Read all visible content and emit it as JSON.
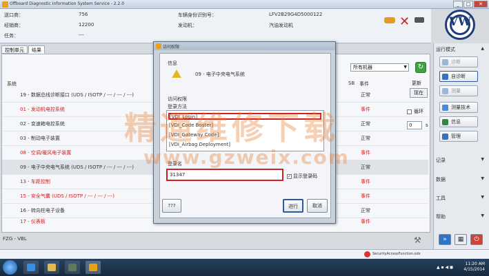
{
  "window": {
    "title": "Offboard Diagnostic Information System Service - 2.2.0",
    "buttons": [
      "_",
      "□",
      "✕"
    ]
  },
  "info": {
    "left_labels": [
      "送口商：",
      "经销商：",
      "任务："
    ],
    "left_values": [
      "756",
      "12200",
      "---"
    ],
    "mid_labels": [
      "车辆身份识别号：",
      "发动机："
    ],
    "mid_values": [
      "LFV2B29G4D5000122",
      "汽油发动机"
    ],
    "logo_text": "VW"
  },
  "tabs": [
    "控制单元",
    "结果"
  ],
  "list": {
    "col_system": "系统",
    "col_sb": "SB",
    "col_event": "事件",
    "filter_value": "所有机器",
    "update_label": "更新",
    "now_button": "现在",
    "cycle_label": "循环",
    "interval_value": "0",
    "interval_unit": "s",
    "rows": [
      {
        "name": "19 - 数据总线诊断接口 (UDS / ISOTP / --- / --- / ---)",
        "status": "正常",
        "err": false
      },
      {
        "name": "01 - 发动机电控系统",
        "status": "事件",
        "err": true
      },
      {
        "name": "02 - 变速箱电控系统",
        "status": "正常",
        "err": false
      },
      {
        "name": "03 - 制动电子装置",
        "status": "正常",
        "err": false
      },
      {
        "name": "08 - 空调/暖风电子装置",
        "status": "事件",
        "err": true
      },
      {
        "name": "09 - 电子中央电气系统 (UDS / ISOTP / --- / --- / ---)",
        "status": "正常",
        "err": false
      },
      {
        "name": "13 - 车距控制",
        "status": "事件",
        "err": true
      },
      {
        "name": "15 - 安全气囊 (UDS / ISOTP / --- / --- / ---)",
        "status": "事件",
        "err": true
      },
      {
        "name": "16 - 转向柱电子设备",
        "status": "正常",
        "err": false
      },
      {
        "name": "17 - 仪表板",
        "status": "事件",
        "err": true
      }
    ]
  },
  "sidebar": {
    "mode_header": "运行模式",
    "buttons": [
      {
        "label": "诊断",
        "disabled": true,
        "color": "#9bb7d9"
      },
      {
        "label": "自诊断",
        "disabled": false,
        "color": "#2f74c9",
        "active": true
      },
      {
        "label": "测量",
        "disabled": true,
        "color": "#9bb7d9"
      },
      {
        "label": "测量技术",
        "disabled": false,
        "color": "#4a8ad6"
      },
      {
        "label": "信息",
        "disabled": false,
        "color": "#2f8a3a"
      },
      {
        "label": "管理",
        "disabled": false,
        "color": "#3b6fb8"
      }
    ],
    "sections": [
      "记录",
      "数据",
      "工具",
      "帮助"
    ]
  },
  "footer": {
    "left_label": "FZG - VBL",
    "security_text": "SecurityAccessFunction.odx"
  },
  "taskbar": {
    "time": "11:20 AM",
    "date": "4/15/2014"
  },
  "dialog": {
    "title": "访问权限",
    "info_header": "信息",
    "info_text": "09 - 电子中央电气系统",
    "access_header": "访问权限",
    "login_method_label": "登录方法",
    "methods": [
      "[VDI_Login]",
      "[VDI_Code Boster]",
      "[VDI_Gateway Code]",
      "[VDI_Airbag Deployment]"
    ],
    "login_name_label": "登录名",
    "login_value": "31347",
    "show_checkbox": "显示登录码",
    "ok_button": "进行",
    "cancel_button": "取消",
    "left_button": "???"
  },
  "watermark": {
    "cn": "精通维修下载",
    "url": "www.gzweix.com"
  },
  "colors": {
    "error": "#d01f1f",
    "accent": "#2c5aa0",
    "logo": "#1f3c7a"
  }
}
